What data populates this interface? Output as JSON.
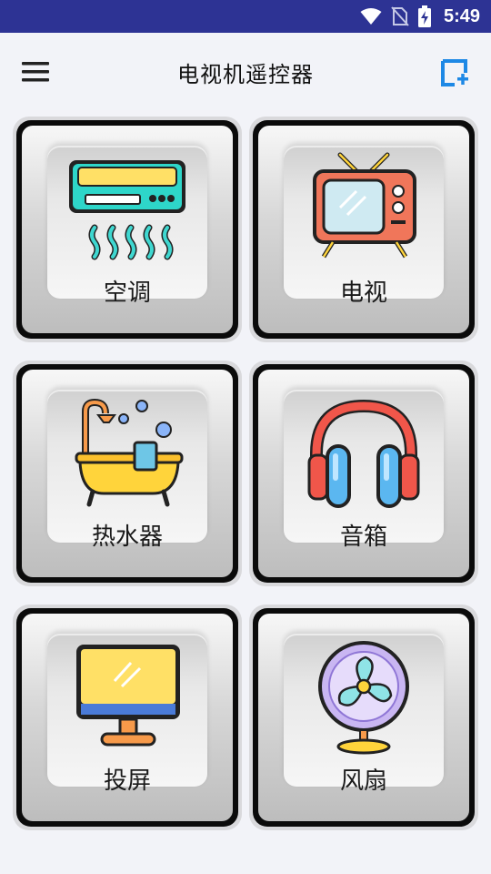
{
  "status_bar": {
    "time": "5:49",
    "icons": [
      "wifi-icon",
      "no-sim-icon",
      "battery-charging-icon"
    ]
  },
  "app_bar": {
    "title": "电视机遥控器",
    "menu_icon": "hamburger-menu-icon",
    "add_icon": "add-device-icon",
    "accent_color": "#1e88e5"
  },
  "devices": [
    {
      "label": "空调",
      "icon": "air-conditioner-icon"
    },
    {
      "label": "电视",
      "icon": "television-icon"
    },
    {
      "label": "热水器",
      "icon": "water-heater-icon"
    },
    {
      "label": "音箱",
      "icon": "headphones-speaker-icon"
    },
    {
      "label": "投屏",
      "icon": "monitor-screen-cast-icon"
    },
    {
      "label": "风扇",
      "icon": "fan-icon"
    }
  ]
}
